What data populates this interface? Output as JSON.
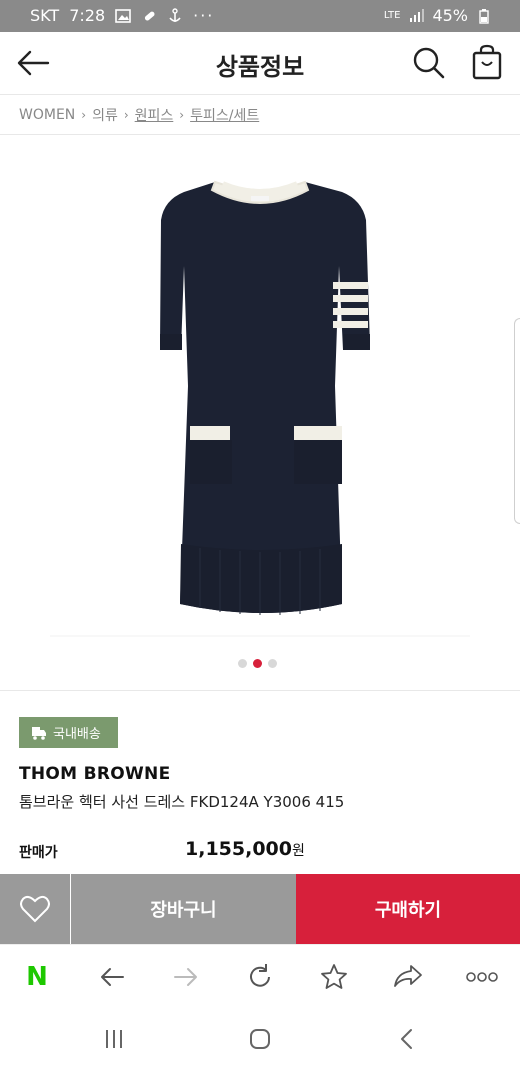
{
  "status_bar": {
    "carrier": "SKT",
    "time": "7:28",
    "network": "LTE",
    "battery": "45%"
  },
  "header": {
    "title": "상품정보",
    "icons": {
      "back": "back-arrow-icon",
      "search": "search-icon",
      "cart": "shopping-bag-icon"
    }
  },
  "breadcrumb": {
    "items": [
      "WOMEN",
      "의류",
      "원피스",
      "투피스/세트"
    ]
  },
  "gallery": {
    "total_slides": 3,
    "active_slide": 2,
    "colors": {
      "active_dot": "#d7203b",
      "inactive_dot": "#d8d8d8",
      "dress": "#1c2233",
      "trim": "#f1efe6"
    }
  },
  "product": {
    "shipping_badge": "국내배송",
    "brand": "THOM BROWNE",
    "name": "톰브라운 헥터 사선 드레스 FKD124A Y3006 415",
    "price_label": "판매가",
    "price": "1,155,000",
    "price_unit": "원"
  },
  "actions": {
    "wishlist_icon": "heart-icon",
    "cart_button": "장바구니",
    "buy_button": "구매하기",
    "colors": {
      "gray": "#9a9a9a",
      "red": "#d7203b"
    }
  },
  "browser_toolbar": {
    "items": [
      "naver-logo-icon",
      "back-icon",
      "forward-icon",
      "refresh-icon",
      "star-icon",
      "share-icon",
      "more-icon"
    ],
    "logo_letter": "N",
    "logo_color": "#1ec800"
  },
  "system_nav": {
    "items": [
      "recent-apps-icon",
      "home-icon",
      "back-icon"
    ]
  }
}
